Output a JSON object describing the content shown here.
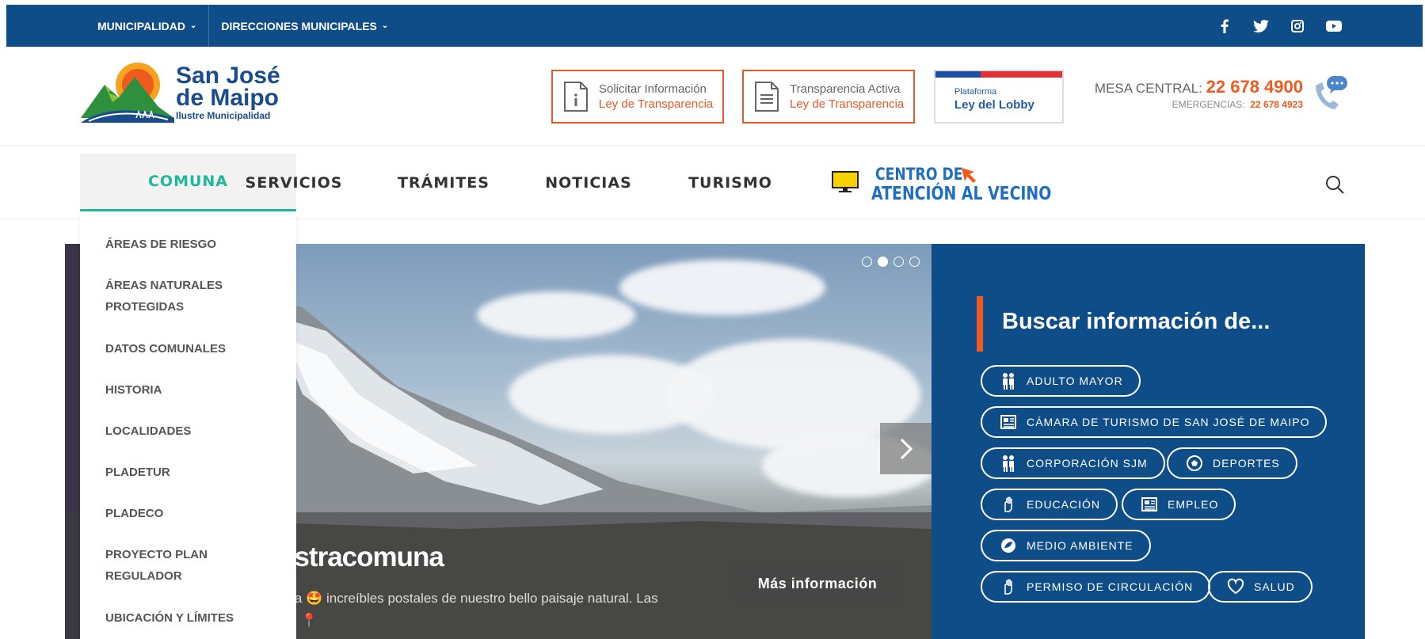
{
  "topbar": {
    "menu": [
      {
        "label": "MUNICIPALIDAD"
      },
      {
        "label": "DIRECCIONES MUNICIPALES"
      }
    ],
    "social": [
      "facebook-icon",
      "twitter-icon",
      "instagram-icon",
      "youtube-icon"
    ]
  },
  "header": {
    "logo": {
      "line1": "San José",
      "line2": "de Maipo",
      "line3": "Ilustre Municipalidad"
    },
    "buttons": [
      {
        "line1": "Solicitar Información",
        "line2": "Ley de Transparencia"
      },
      {
        "line1": "Transparencia Activa",
        "line2": "Ley de Transparencia"
      }
    ],
    "lobby": {
      "line1": "Plataforma",
      "line2": "Ley del Lobby"
    },
    "contact": {
      "central_label": "MESA CENTRAL:",
      "central_number": "22 678 4900",
      "emergency_label": "EMERGENCIAS:",
      "emergency_number": "22 678 4923"
    }
  },
  "nav": {
    "items": [
      "COMUNA",
      "SERVICIOS",
      "TRÁMITES",
      "NOTICIAS",
      "TURISMO"
    ],
    "cav_line1": "CENTRO DE",
    "cav_line2": "ATENCIÓN AL VECINO"
  },
  "dropdown": {
    "items": [
      "ÁREAS DE RIESGO",
      "ÁREAS NATURALES PROTEGIDAS",
      "DATOS COMUNALES",
      "HISTORIA",
      "LOCALIDADES",
      "PLADETUR",
      "PLADECO",
      "PROYECTO PLAN REGULADOR",
      "UBICACIÓN Y LÍMITES"
    ]
  },
  "slider": {
    "title": "estracomuna",
    "text_line1": "una 🤩 increíbles postales de nuestro bello paisaje natural. Las",
    "text_line2": "lfal 📍",
    "more_label": "Más información",
    "slide_count": 4,
    "active_slide": 2
  },
  "search_panel": {
    "title": "Buscar información de...",
    "pills": [
      {
        "label": "ADULTO MAYOR",
        "icon": "people-icon"
      },
      {
        "label": "CÁMARA DE TURISMO DE SAN JOSÉ DE MAIPO",
        "icon": "newspaper-icon"
      },
      {
        "label": "CORPORACIÓN SJM",
        "icon": "people-icon"
      },
      {
        "label": "DEPORTES",
        "icon": "soccer-ball-icon"
      },
      {
        "label": "EDUCACIÓN",
        "icon": "hand-icon"
      },
      {
        "label": "EMPLEO",
        "icon": "newspaper-icon"
      },
      {
        "label": "MEDIO AMBIENTE",
        "icon": "environment-icon"
      },
      {
        "label": "PERMISO DE CIRCULACIÓN",
        "icon": "hand-icon"
      },
      {
        "label": "SALUD",
        "icon": "heart-icon"
      }
    ]
  },
  "colors": {
    "primary": "#0f4d88",
    "accent": "#f05a1e",
    "active_nav": "#1fb89a"
  }
}
